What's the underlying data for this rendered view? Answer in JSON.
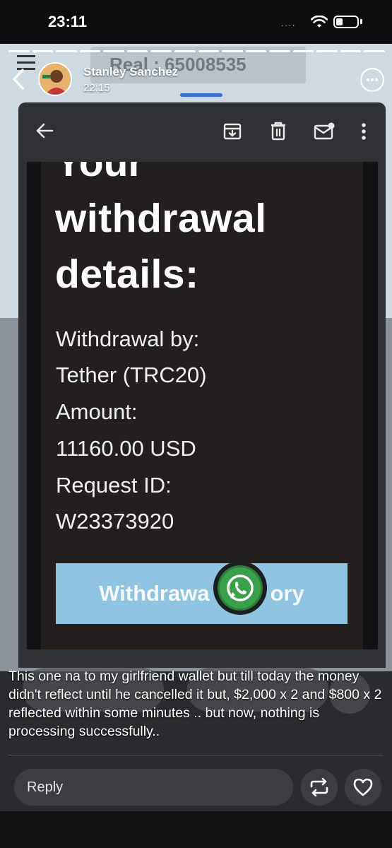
{
  "status_bar": {
    "time": "23:11",
    "signal_dots": "....",
    "wifi_icon": "wifi-icon",
    "battery_icon": "battery-icon"
  },
  "background_app": {
    "account_label": "Real : 65008535"
  },
  "story": {
    "username": "Stanley Sanchez",
    "timestamp": "22:15",
    "progress_segments": 16
  },
  "email": {
    "toolbar_icons": [
      "arrow-back-icon",
      "archive-icon",
      "trash-icon",
      "mark-unread-icon",
      "more-vertical-icon"
    ],
    "title_cut": "Your",
    "title_lines": [
      "withdrawal",
      "details:"
    ],
    "details": [
      "Withdrawal by:",
      "Tether (TRC20)",
      "Amount:",
      "11160.00 USD",
      "Request ID:",
      "W23373920"
    ],
    "history_button_left": "Withdrawa",
    "history_button_right": "ory"
  },
  "caption": "This one na to my girlfriend wallet but till today the money didn't reflect until he cancelled it but, $2,000 x 2 and $800 x 2 reflected within some minutes .. but now, nothing is processing successfully..",
  "reply": {
    "placeholder": "Reply"
  },
  "colors": {
    "accent_blue": "#3d6fd8",
    "whatsapp_green": "#3aa14a",
    "history_button": "#8fc4e0"
  }
}
